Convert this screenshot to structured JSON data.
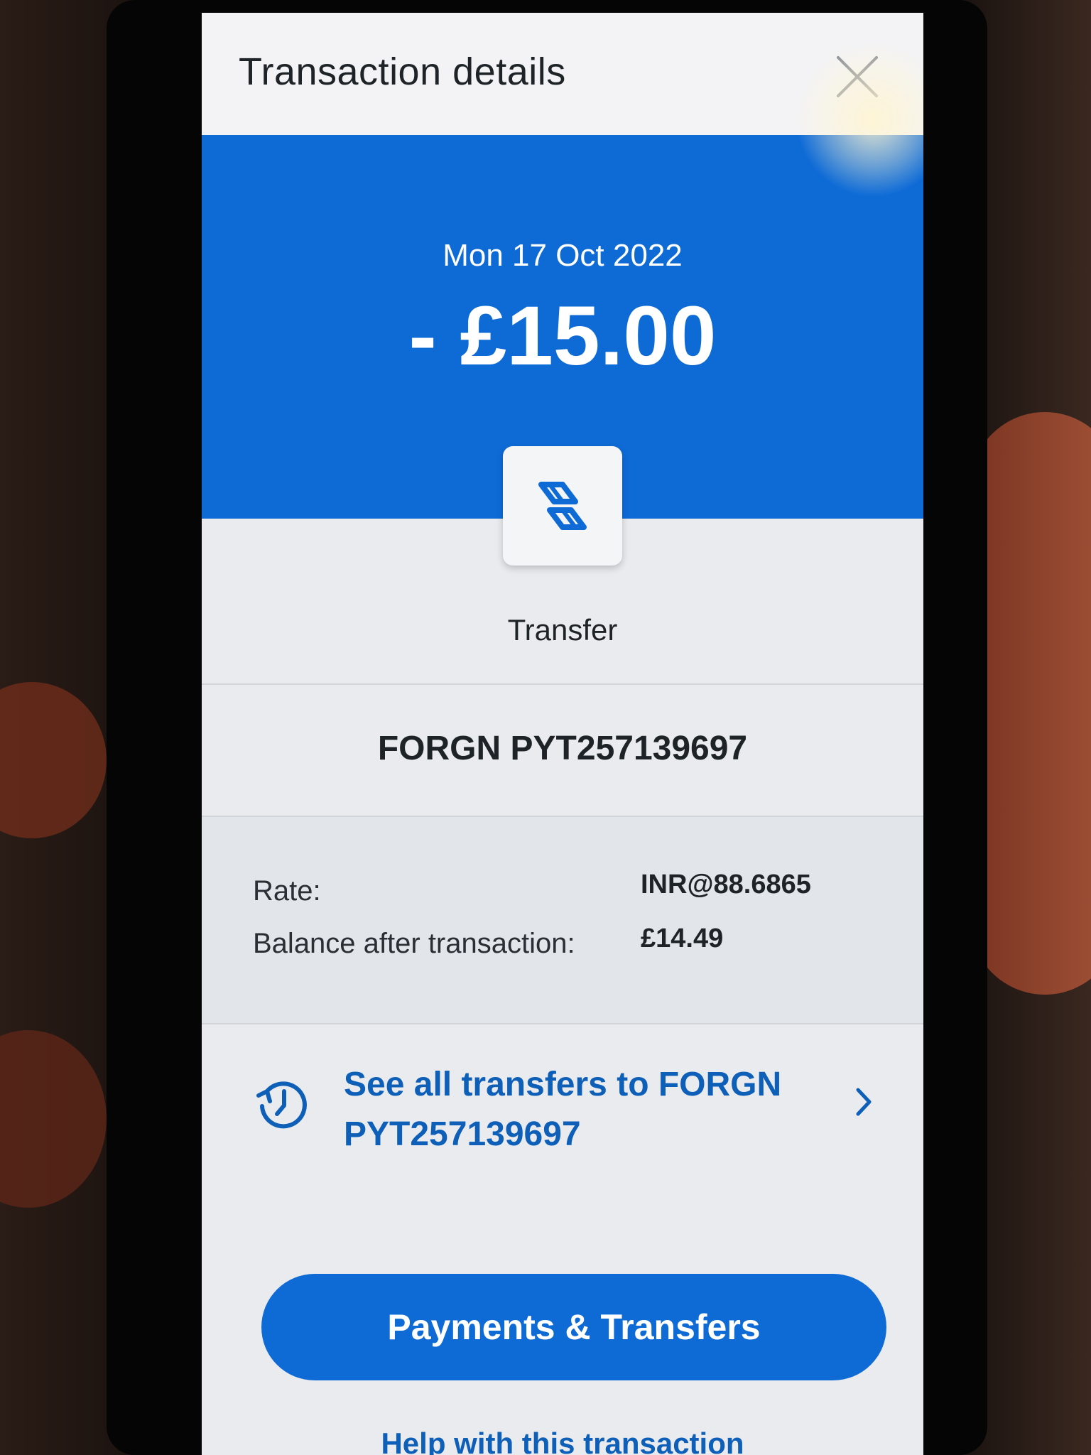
{
  "header": {
    "title": "Transaction details",
    "close_icon": "close-icon"
  },
  "hero": {
    "date": "Mon 17 Oct 2022",
    "amount": "- £15.00",
    "background_color": "#0e6bd6"
  },
  "transaction_type": {
    "icon": "transfer-icon",
    "label": "Transfer"
  },
  "payee": "FORGN PYT257139697",
  "details": {
    "rate_label": "Rate:",
    "rate_value": "INR@88.6865",
    "balance_label": "Balance after transaction:",
    "balance_value": "£14.49"
  },
  "see_all": {
    "icon": "history-icon",
    "text_line1": "See all transfers to FORGN",
    "text_line2": "PYT257139697",
    "chevron_icon": "chevron-right-icon"
  },
  "actions": {
    "primary_label": "Payments & Transfers",
    "help_label": "Help with this transaction"
  },
  "colors": {
    "accent": "#0e6bd6",
    "link": "#0e5fb8"
  }
}
